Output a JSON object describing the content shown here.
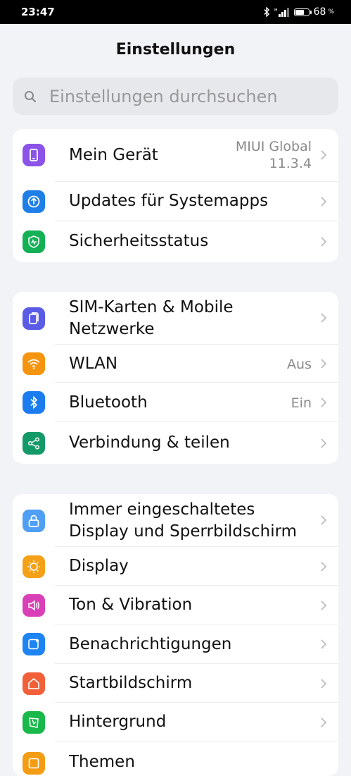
{
  "status_bar": {
    "time": "23:47",
    "battery": "68",
    "battery_unit": "%"
  },
  "header": {
    "title": "Einstellungen"
  },
  "search": {
    "placeholder": "Einstellungen durchsuchen"
  },
  "sections": [
    {
      "items": [
        {
          "label": "Mein Gerät",
          "value_line1": "MIUI Global",
          "value_line2": "11.3.4",
          "icon": "phone-icon",
          "color": "#8b53e8"
        },
        {
          "label": "Updates für Systemapps",
          "icon": "update-icon",
          "color": "#1e7fe6"
        },
        {
          "label": "Sicherheitsstatus",
          "icon": "shield-icon",
          "color": "#14b056"
        }
      ]
    },
    {
      "items": [
        {
          "label_line1": "SIM-Karten & Mobile",
          "label_line2": "Netzwerke",
          "icon": "sim-icon",
          "color": "#5b5ce6"
        },
        {
          "label": "WLAN",
          "value": "Aus",
          "icon": "wifi-icon",
          "color": "#f5950f"
        },
        {
          "label": "Bluetooth",
          "value": "Ein",
          "icon": "bluetooth-icon",
          "color": "#1b7cf0"
        },
        {
          "label": "Verbindung & teilen",
          "icon": "share-icon",
          "color": "#149a68"
        }
      ]
    },
    {
      "items": [
        {
          "label_line1": "Immer eingeschaltetes",
          "label_line2": "Display und Sperrbildschirm",
          "icon": "lock-icon",
          "color": "#4f9ff5"
        },
        {
          "label": "Display",
          "icon": "sun-icon",
          "color": "#f5a118"
        },
        {
          "label": "Ton & Vibration",
          "icon": "speaker-icon",
          "color": "#d940b8"
        },
        {
          "label": "Benachrichtigungen",
          "icon": "notification-icon",
          "color": "#1d84f2"
        },
        {
          "label": "Startbildschirm",
          "icon": "home-icon",
          "color": "#f2603a"
        },
        {
          "label": "Hintergrund",
          "icon": "wallpaper-icon",
          "color": "#18b84a"
        },
        {
          "label": "Themen",
          "icon": "theme-icon",
          "color": "#f59c15"
        }
      ]
    }
  ]
}
